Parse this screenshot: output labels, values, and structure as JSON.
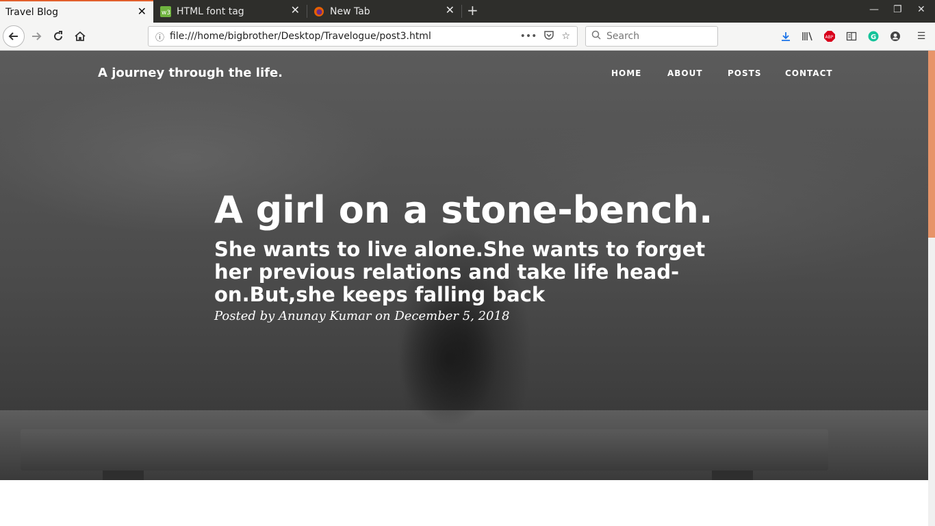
{
  "browser": {
    "tabs": [
      {
        "title": "Travel Blog",
        "active": true
      },
      {
        "title": "HTML font tag",
        "active": false
      },
      {
        "title": "New Tab",
        "active": false
      }
    ],
    "url": "file:///home/bigbrother/Desktop/Travelogue/post3.html",
    "search_placeholder": "Search",
    "accent_color": "#e2602c"
  },
  "site": {
    "brand": "A journey through the life.",
    "nav": [
      "HOME",
      "ABOUT",
      "POSTS",
      "CONTACT"
    ]
  },
  "post": {
    "title": "A girl on a stone-bench.",
    "subtitle": "She wants to live alone.She wants to forget her previous relations and take life head-on.But,she keeps falling back",
    "meta": "Posted by Anunay Kumar on December 5, 2018"
  },
  "scrollbar": {
    "thumb_color": "#e79469"
  }
}
